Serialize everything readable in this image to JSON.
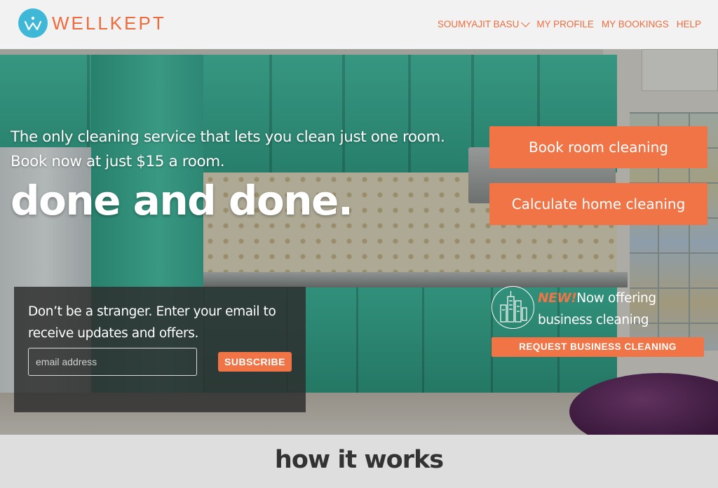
{
  "brand": {
    "name": "WELLKEPT",
    "accent": "#ee6c3c",
    "logo_color": "#3fb8d8"
  },
  "nav": {
    "user": "SOUMYAJIT BASU",
    "items": [
      "MY PROFILE",
      "MY BOOKINGS",
      "HELP"
    ]
  },
  "hero": {
    "tagline_line1": "The only cleaning service that lets you clean just one room.",
    "tagline_line2": "Book now at just $15 a room.",
    "headline": "done and done.",
    "book_button": "Book room cleaning",
    "calc_button": "Calculate home cleaning"
  },
  "subscribe": {
    "text": "Don’t be a stranger. Enter your email to receive updates and offers.",
    "placeholder": "email address",
    "button": "SUBSCRIBE"
  },
  "business": {
    "new_label": "NEW!",
    "line1": "Now offering",
    "line2": "business cleaning",
    "button": "REQUEST BUSINESS CLEANING",
    "icon": "city-skyline-icon"
  },
  "how_it_works": {
    "title": "how it works"
  }
}
